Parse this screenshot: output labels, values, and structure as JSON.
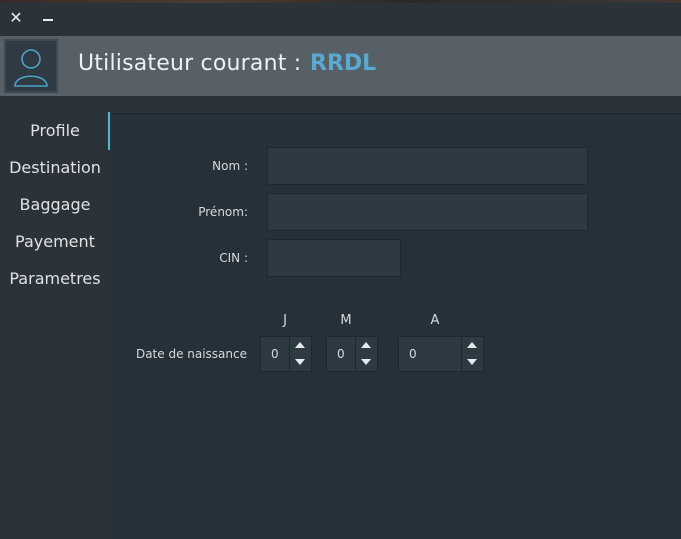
{
  "window": {
    "close_glyph": "✕"
  },
  "header": {
    "title": "Utilisateur courant :",
    "user": "RRDL",
    "accent": "#5aa9d0"
  },
  "sidebar": {
    "items": [
      {
        "label": "Profile",
        "active": true
      },
      {
        "label": "Destination"
      },
      {
        "label": "Baggage"
      },
      {
        "label": "Payement"
      },
      {
        "label": "Parametres"
      }
    ]
  },
  "form": {
    "nom_label": "Nom :",
    "nom_value": "",
    "prenom_label": "Prénom:",
    "prenom_value": "",
    "cin_label": "CIN :",
    "cin_value": "",
    "dob_label": "Date de naissance",
    "dob": {
      "day_header": "J",
      "month_header": "M",
      "year_header": "A",
      "day": "0",
      "month": "0",
      "year": "0"
    }
  }
}
